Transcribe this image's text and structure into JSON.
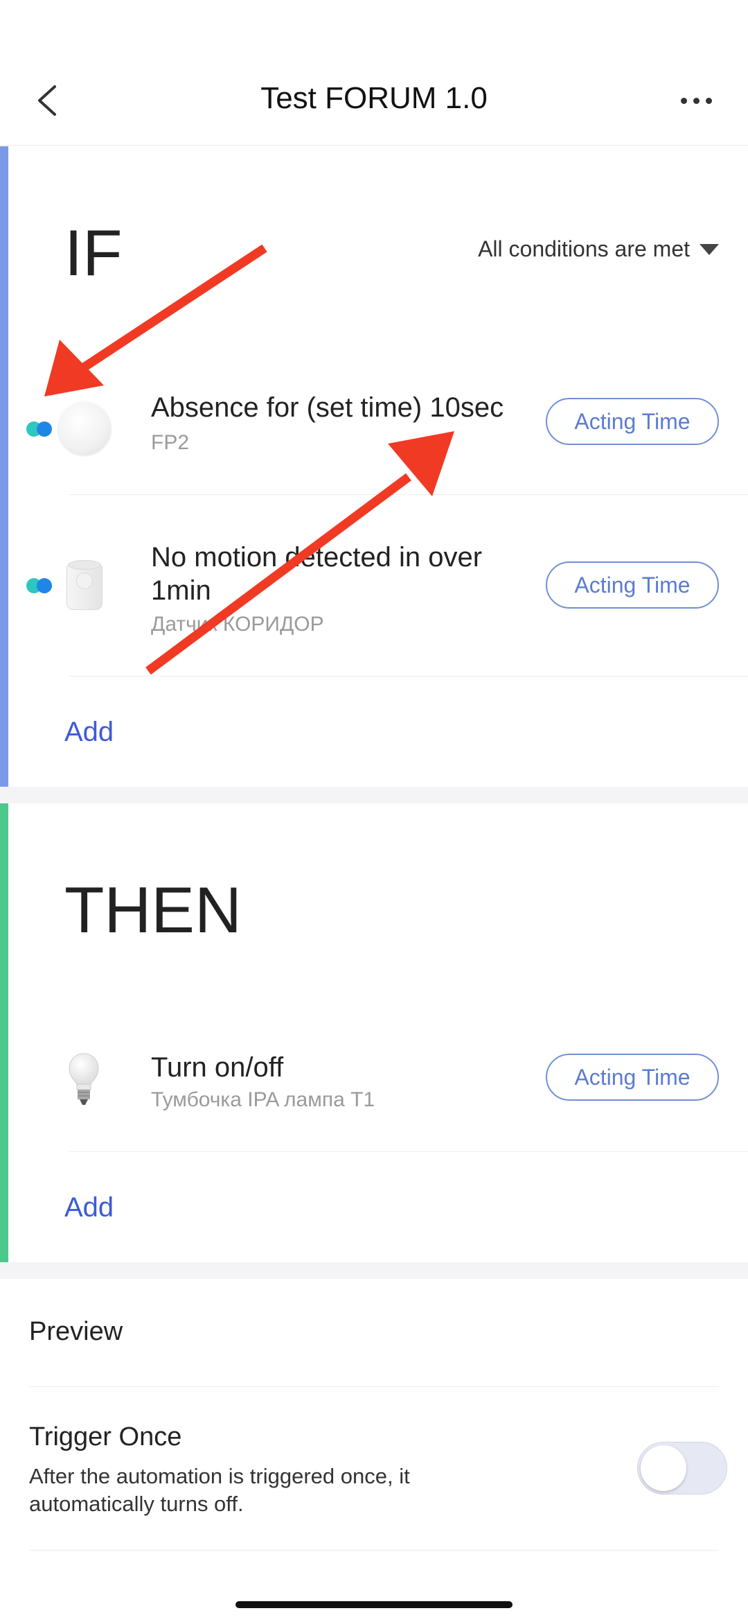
{
  "header": {
    "title": "Test FORUM 1.0",
    "back_icon": "chevron-left-icon",
    "more_icon": "more-horizontal-icon"
  },
  "if_section": {
    "heading": "IF",
    "condition_mode": "All conditions are met",
    "accent_color": "#7b9be8",
    "conditions": [
      {
        "title": "Absence for (set time) 10sec",
        "device": "FP2",
        "button": "Acting Time",
        "icon": "fp2-presence-sensor-icon"
      },
      {
        "title": "No motion detected in over 1min",
        "device": "Датчик КОРИДОР",
        "button": "Acting Time",
        "icon": "motion-sensor-icon"
      }
    ],
    "add_label": "Add"
  },
  "then_section": {
    "heading": "THEN",
    "accent_color": "#4cc98a",
    "actions": [
      {
        "title": "Turn on/off",
        "device": "Тумбочка IPA лампа  T1",
        "button": "Acting Time",
        "icon": "light-bulb-icon"
      }
    ],
    "add_label": "Add"
  },
  "preview": {
    "label": "Preview"
  },
  "trigger_once": {
    "title": "Trigger Once",
    "description": "After the automation is triggered once, it automatically turns off.",
    "toggle_on": false
  },
  "colors": {
    "link_blue": "#3d5bd6",
    "button_outline": "#6f8fd6",
    "annotation_red": "#f03a24"
  }
}
